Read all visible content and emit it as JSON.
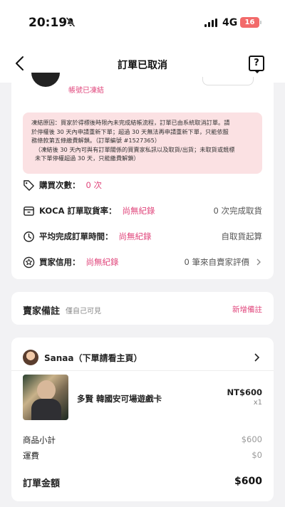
{
  "status_bar": {
    "time": "20:19",
    "network": "4G",
    "battery": "16"
  },
  "nav": {
    "title": "訂單已取消",
    "help_glyph": "?"
  },
  "account": {
    "frozen_label": "帳號已凍結"
  },
  "notice": {
    "line1": "凍結原因：買家於得標後時限內未完成結帳流程，訂單已由系統取消訂單。請",
    "line2": "於停權後 30 天內申請重新下單；超過 30 天無法再申請重新下單，只能依服",
    "line3": "務條款第五條繳費解鎖。（訂單編號 #1527365）",
    "line4": "（凍結後 30 天內可與有訂單關係的買賣家私訊以及取貨/出貨；未取貨或競標",
    "line5": "未下單停權超過 30 天，只能繳費解鎖）"
  },
  "info": {
    "purchase_count_label": "購買次數：",
    "purchase_count_value": "0 次",
    "pickup_rate_label": "KOCA 訂單取貨率：",
    "pickup_rate_value": "尚無紀錄",
    "pickup_rate_right": "0 次完成取貨",
    "avg_time_label": "平均完成訂單時間：",
    "avg_time_value": "尚無紀錄",
    "avg_time_right": "自取貨起算",
    "credit_label": "買家信用：",
    "credit_value": "尚無紀錄",
    "credit_right": "0 筆來自賣家評價"
  },
  "buyer_note": {
    "title": "賣家備註",
    "subtitle": "僅自己可見",
    "add_label": "新增備註"
  },
  "order": {
    "seller_name": "Sanaa（下單請看主頁）",
    "product_name": "多賢 韓國安可場遊戲卡",
    "price": "NT$600",
    "quantity": "x1",
    "subtotal_label": "商品小計",
    "subtotal_value": "$600",
    "shipping_label": "運費",
    "shipping_value": "$0",
    "total_label": "訂單金額",
    "total_value": "$600"
  },
  "colors": {
    "accent": "#e0457b",
    "notice_bg": "#fbe1e3",
    "battery_bg": "#f26a6a",
    "page_bg": "#f2f2f4"
  },
  "icons": [
    "mute-icon",
    "signal-icon",
    "back-icon",
    "help-icon",
    "tag-icon",
    "box-icon",
    "clock-icon",
    "star-icon",
    "chevron-right-icon"
  ]
}
